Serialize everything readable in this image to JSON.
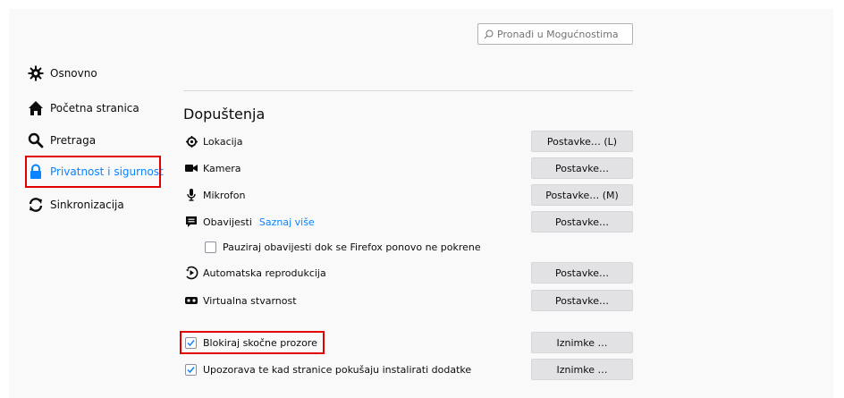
{
  "search": {
    "placeholder": "Pronađi u Mogućnostima"
  },
  "sidebar": {
    "items": [
      {
        "label": "Osnovno",
        "icon": "gear-icon"
      },
      {
        "label": "Početna stranica",
        "icon": "home-icon"
      },
      {
        "label": "Pretraga",
        "icon": "search-icon"
      },
      {
        "label": "Privatnost i sigurnost",
        "icon": "lock-icon",
        "selected": true
      },
      {
        "label": "Sinkronizacija",
        "icon": "sync-icon"
      }
    ]
  },
  "permissions": {
    "heading": "Dopuštenja",
    "rows": [
      {
        "label": "Lokacija",
        "icon": "location-icon",
        "button": "Postavke… (L)"
      },
      {
        "label": "Kamera",
        "icon": "camera-icon",
        "button": "Postavke…"
      },
      {
        "label": "Mikrofon",
        "icon": "microphone-icon",
        "button": "Postavke… (M)"
      },
      {
        "label": "Obavijesti",
        "icon": "notification-icon",
        "button": "Postavke…",
        "link": "Saznaj više"
      },
      {
        "label": "Automatska reprodukcija",
        "icon": "autoplay-icon",
        "button": "Postavke…"
      },
      {
        "label": "Virtualna stvarnost",
        "icon": "vr-icon",
        "button": "Postavke…"
      }
    ],
    "pause_notifications": {
      "label": "Pauziraj obavijesti dok se Firefox ponovo ne pokrene",
      "checked": false
    },
    "block_popups": {
      "label": "Blokiraj skočne prozore",
      "checked": true,
      "button": "Iznimke …"
    },
    "warn_addons": {
      "label": "Upozorava te kad stranice pokušaju instalirati dodatke",
      "checked": true,
      "button": "Iznimke …"
    }
  },
  "colors": {
    "accent": "#0a84ff",
    "highlight": "#e00000"
  }
}
